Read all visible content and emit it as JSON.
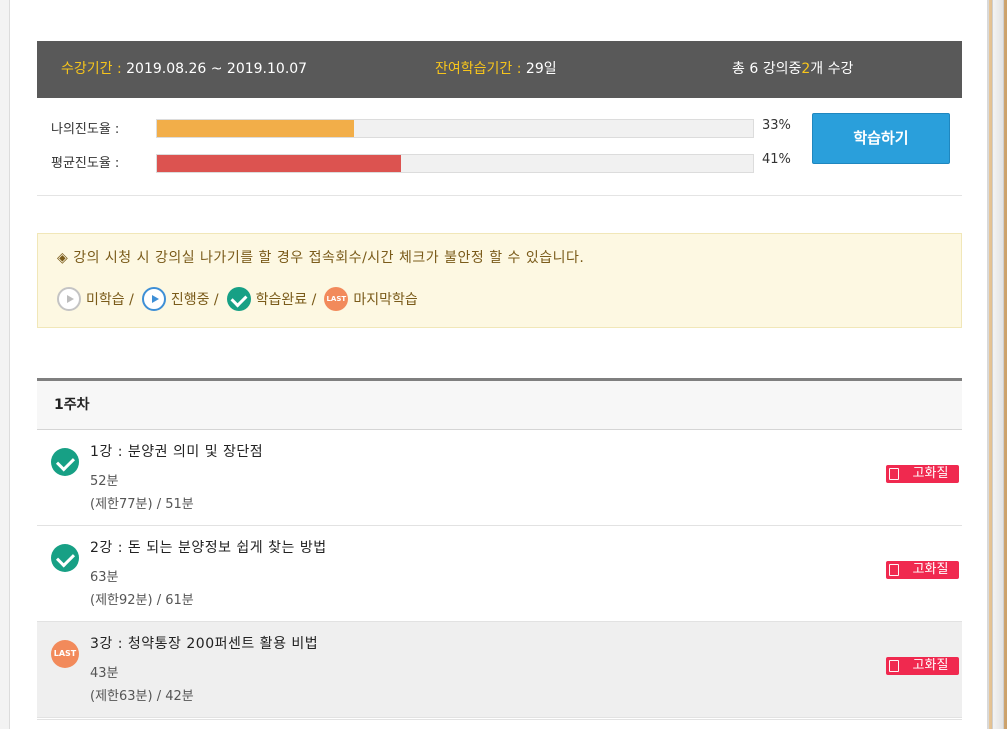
{
  "period": {
    "enroll_label": "수강기간 :",
    "enroll_value": "2019.08.26 ~ 2019.10.07",
    "remain_label": "잔여학습기간 :",
    "remain_value": "29일",
    "total_prefix": "총",
    "total_count": "6",
    "total_mid": "강의중",
    "taken_count": "2",
    "total_suffix": "개 수강"
  },
  "progress": {
    "mine_label": "나의진도율 :",
    "mine_percent_text": "33%",
    "mine_value": 33,
    "mine_color": "#f2ae49",
    "avg_label": "평균진도율 :",
    "avg_percent_text": "41%",
    "avg_value": 41,
    "avg_color": "#dc5350",
    "study_button": "학습하기"
  },
  "notice": {
    "text": "◈ 강의 시청 시 강의실 나가기를 할 경우 접속회수/시간 체크가 불안정 할 수 있습니다.",
    "legend": [
      {
        "icon": "pending-play-icon",
        "label": "미학습 /"
      },
      {
        "icon": "in-progress-play-icon",
        "label": "진행중 /"
      },
      {
        "icon": "completed-check-icon",
        "label": "학습완료 /"
      },
      {
        "icon": "last-badge-icon",
        "icon_text": "LAST",
        "label": "마지막학습"
      }
    ]
  },
  "week": {
    "title": "1주차",
    "lectures": [
      {
        "status": "done",
        "title": "1강 : 분양권 의미 및 장단점",
        "duration": "52분",
        "limit": "(제한77분) / 51분",
        "hq_label": "고화질"
      },
      {
        "status": "done",
        "title": "2강 : 돈 되는 분양정보 쉽게 찾는 방법",
        "duration": "63분",
        "limit": "(제한92분) / 61분",
        "hq_label": "고화질"
      },
      {
        "status": "last",
        "icon_text": "LAST",
        "title": "3강 : 청약통장 200퍼센트 활용 비법",
        "duration": "43분",
        "limit": "(제한63분) / 42분",
        "hq_label": "고화질"
      }
    ]
  }
}
